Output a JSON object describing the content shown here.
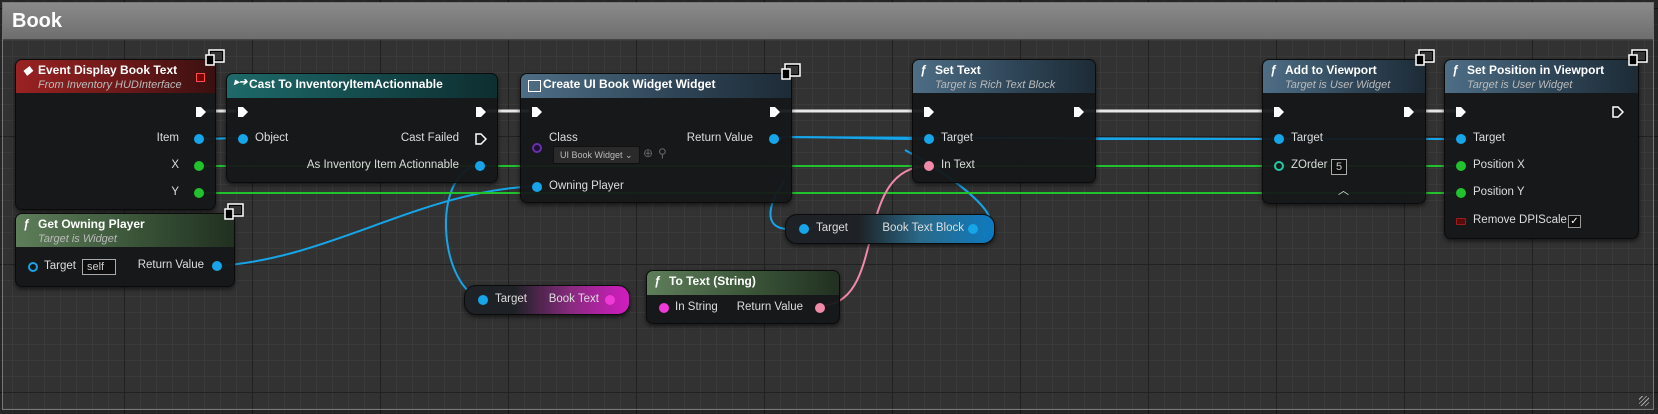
{
  "comment": {
    "title": "Book"
  },
  "nodes": {
    "event": {
      "title": "Event Display Book Text",
      "subtitle": "From Inventory HUDInterface",
      "pins": {
        "item": "Item",
        "x": "X",
        "y": "Y"
      }
    },
    "cast": {
      "title": "Cast To InventoryItemActionnable",
      "pins": {
        "object": "Object",
        "cast_failed": "Cast Failed",
        "as_item": "As Inventory Item Actionnable"
      }
    },
    "create": {
      "title": "Create UI Book Widget Widget",
      "pins": {
        "class": "Class",
        "class_value": "UI Book Widget",
        "return_value": "Return Value",
        "owning_player": "Owning Player"
      }
    },
    "set_text": {
      "title": "Set Text",
      "subtitle": "Target is Rich Text Block",
      "pins": {
        "target": "Target",
        "in_text": "In Text"
      }
    },
    "add_viewport": {
      "title": "Add to Viewport",
      "subtitle": "Target is User Widget",
      "pins": {
        "target": "Target",
        "zorder": "ZOrder",
        "zorder_value": "5"
      }
    },
    "set_position": {
      "title": "Set Position in Viewport",
      "subtitle": "Target is User Widget",
      "pins": {
        "target": "Target",
        "position_x": "Position X",
        "position_y": "Position Y",
        "remove_dpi": "Remove DPIScale",
        "remove_dpi_checked": "✓"
      }
    },
    "get_owning": {
      "title": "Get Owning Player",
      "subtitle": "Target is Widget",
      "pins": {
        "target": "Target",
        "target_value": "self",
        "return_value": "Return Value"
      }
    },
    "book_text_block": {
      "pins": {
        "target": "Target",
        "output": "Book Text Block"
      }
    },
    "book_text": {
      "pins": {
        "target": "Target",
        "output": "Book Text"
      }
    },
    "to_text": {
      "title": "To Text (String)",
      "pins": {
        "in_string": "In String",
        "return_value": "Return Value"
      }
    }
  },
  "colors": {
    "exec": "#ffffff",
    "object": "#16a5e8",
    "float": "#22c12e",
    "text": "#f08aa8",
    "string": "#f03ad8",
    "class": "#6a2fb0",
    "integer": "#27c8a5"
  }
}
